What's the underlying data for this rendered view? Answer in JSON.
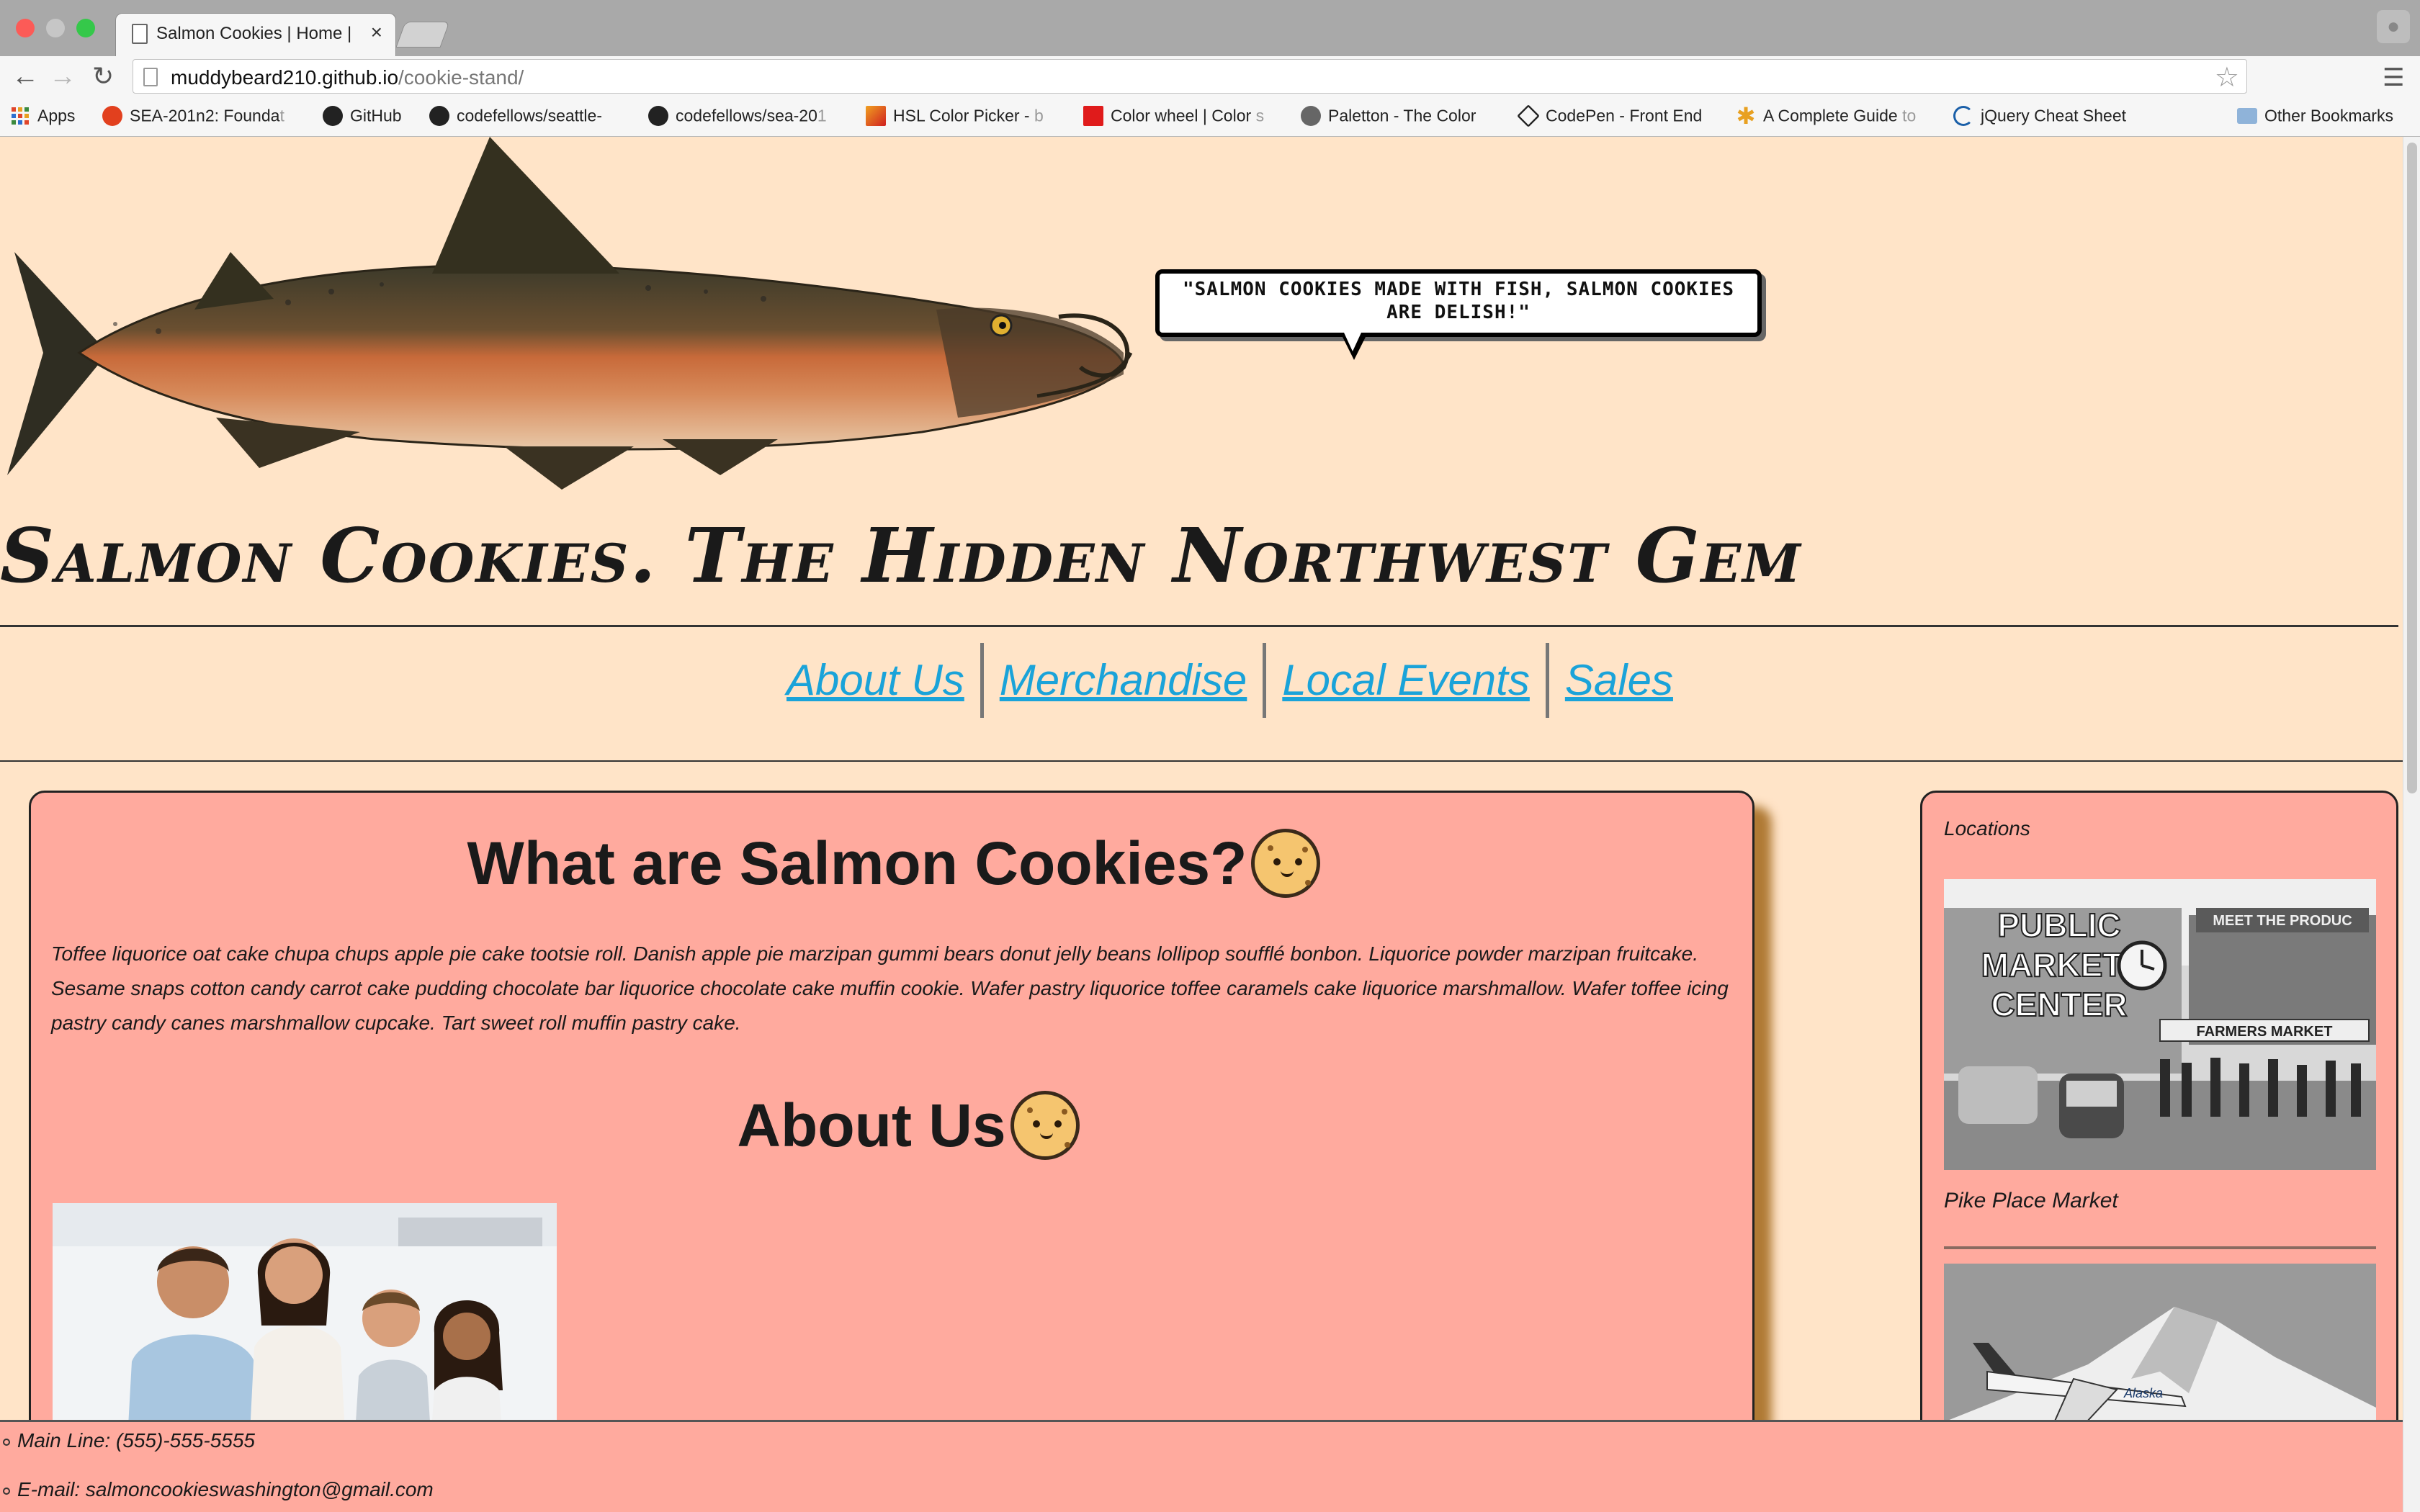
{
  "browser": {
    "tab_title": "Salmon Cookies | Home |",
    "url_host": "muddybeard210.github.io",
    "url_path": "/cookie-stand/",
    "bookmarks": [
      {
        "label": "Apps",
        "icon": "apps-grid-icon",
        "faded": ""
      },
      {
        "label": "SEA-201n2: Founda",
        "icon": "canvas-icon",
        "faded": "t"
      },
      {
        "label": "GitHub",
        "icon": "github-icon",
        "faded": ""
      },
      {
        "label": "codefellows/seattle-",
        "icon": "github-icon",
        "faded": ""
      },
      {
        "label": "codefellows/sea-20",
        "icon": "github-icon",
        "faded": "1"
      },
      {
        "label": "HSL Color Picker - ",
        "icon": "color-picker-icon",
        "faded": "b"
      },
      {
        "label": "Color wheel | Color ",
        "icon": "adobe-icon",
        "faded": "s"
      },
      {
        "label": "Paletton - The Color",
        "icon": "paletton-icon",
        "faded": ""
      },
      {
        "label": "CodePen - Front End",
        "icon": "codepen-icon",
        "faded": ""
      },
      {
        "label": "A Complete Guide ",
        "icon": "css-tricks-icon",
        "faded": "to"
      },
      {
        "label": "jQuery Cheat Sheet",
        "icon": "jquery-icon",
        "faded": ""
      }
    ],
    "other_bookmarks": "Other Bookmarks"
  },
  "header": {
    "quote": "\"SALMON COOKIES MADE WITH FISH, SALMON COOKIES ARE DELISH!\"",
    "site_title": "Salmon Cookies. The Hidden Northwest Gem"
  },
  "nav": {
    "about": "About Us",
    "merch": "Merchandise",
    "events": "Local Events",
    "sales": "Sales"
  },
  "main": {
    "what_heading": "What are Salmon Cookies?",
    "intro": "Toffee liquorice oat cake chupa chups apple pie cake tootsie roll. Danish apple pie marzipan gummi bears donut jelly beans lollipop soufflé bonbon. Liquorice powder marzipan fruitcake. Sesame snaps cotton candy carrot cake pudding chocolate bar liquorice chocolate cake muffin cookie. Wafer pastry liquorice toffee caramels cake liquorice marshmallow. Wafer toffee icing pastry candy canes marshmallow cupcake. Tart sweet roll muffin pastry cake.",
    "about_heading": "About Us"
  },
  "sidebar": {
    "title": "Locations",
    "pike_photo_text": {
      "line1": "PUBLIC",
      "line2": "MARKET",
      "line3": "CENTER",
      "sign_right": "MEET THE PRODUC",
      "farmers": "FARMERS MARKET"
    },
    "pike_caption": "Pike Place Market",
    "plane_livery": "Alaska"
  },
  "footer": {
    "main_line": "Main Line: (555)-555-5555",
    "email": "E-mail: salmoncookieswashington@gmail.com"
  },
  "colors": {
    "page_bg": "#ffe4c8",
    "card_bg": "#ffaa9e",
    "link": "#1aa3d9"
  }
}
